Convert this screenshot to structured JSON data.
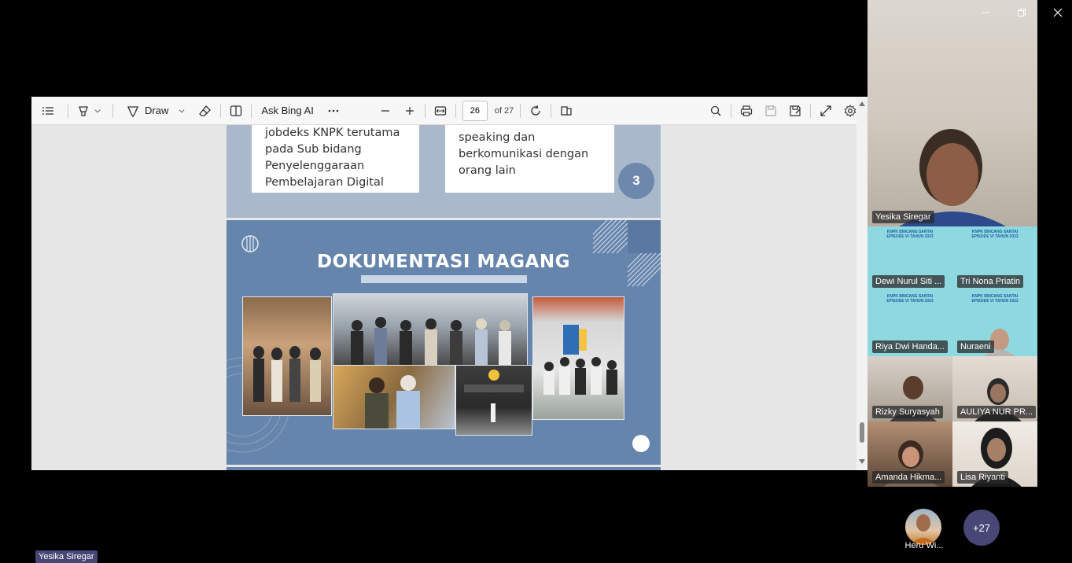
{
  "toolbar": {
    "draw_label": "Draw",
    "ask_label": "Ask Bing AI",
    "current_page": "26",
    "page_total": "of 27"
  },
  "slide_top": {
    "left_lines": [
      "jobdeks KNPK terutama",
      "pada Sub bidang",
      "Penyelenggaraan",
      "Pembelajaran Digital"
    ],
    "right_lines": [
      "speaking dan",
      "berkomunikasi dengan",
      "orang lain"
    ],
    "badge": "3"
  },
  "slide_doc": {
    "title": "DOKUMENTASI MAGANG"
  },
  "participants": [
    {
      "name": "Yesika Siregar"
    },
    {
      "name": "Dewi Nurul Siti ..."
    },
    {
      "name": "Tri Nona Priatin"
    },
    {
      "name": "Riya Dwi Handa..."
    },
    {
      "name": "Nuraeni"
    },
    {
      "name": "Rizky Suryasyah"
    },
    {
      "name": "AULIYA NUR PR..."
    },
    {
      "name": "Amanda Hikma..."
    },
    {
      "name": "Lisa Riyanti"
    }
  ],
  "bottom": {
    "host_name": "Heru Wi...",
    "more_count": "+27",
    "speaker_label": "Yesika Siregar"
  }
}
